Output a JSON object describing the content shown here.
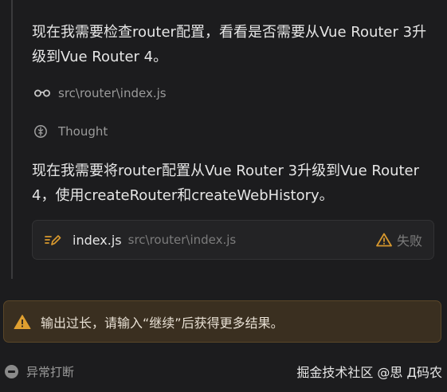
{
  "messages": {
    "para1": "现在我需要检查router配置，看看是否需要从Vue Router 3升级到Vue Router 4。",
    "para2": "现在我需要将router配置从Vue Router 3升级到Vue Router 4，使用createRouter和createWebHistory。"
  },
  "steps": {
    "read_file": {
      "icon": "glasses-icon",
      "label": "src\\router\\index.js"
    },
    "thought": {
      "icon": "thought-icon",
      "label": "Thought"
    }
  },
  "file_card": {
    "icon": "edit-icon",
    "name": "index.js",
    "path": "src\\router\\index.js",
    "status_icon": "warning-icon",
    "status": "失败"
  },
  "banner": {
    "icon": "warning-icon",
    "text": "输出过长，请输入“继续”后获得更多结果。"
  },
  "footer": {
    "stop_icon": "stop-icon",
    "stop_label": "异常打断",
    "watermark": "掘金技术社区 @思 Д码农"
  },
  "colors": {
    "background": "#1c1c1e",
    "warning": "#d7982e",
    "banner_bg": "#3a2f20"
  }
}
